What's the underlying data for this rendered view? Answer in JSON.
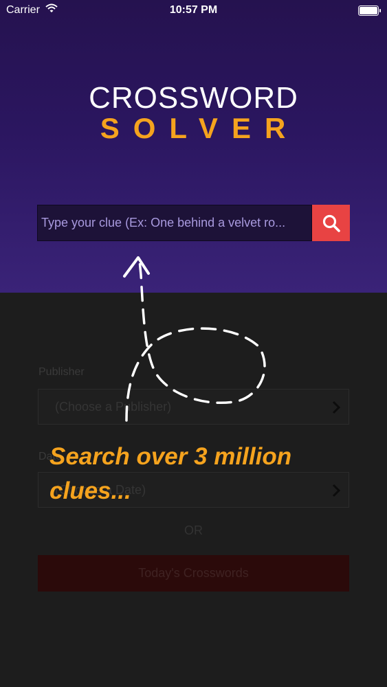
{
  "status_bar": {
    "carrier": "Carrier",
    "time": "10:57 PM",
    "wifi_icon": "wifi-icon",
    "battery_icon": "battery-icon"
  },
  "logo": {
    "line1": "CROSSWORD",
    "line2": "SOLVER"
  },
  "search": {
    "placeholder": "Type your clue (Ex: One behind a velvet ro...",
    "value": "",
    "button_icon": "search-icon"
  },
  "form": {
    "publisher_label": "Publisher",
    "publisher_value": "(Choose a Publisher)",
    "date_label": "Date",
    "date_value": "(Choose a Date)",
    "or_text": "OR",
    "today_button": "Today's Crosswords"
  },
  "overlay": {
    "promo_text": "Search over 3 million clues..."
  },
  "colors": {
    "hero_top": "#25124f",
    "hero_bottom": "#3a2378",
    "accent_orange": "#f5a31e",
    "search_button": "#e84343",
    "dim_background": "#1d1d1d"
  }
}
